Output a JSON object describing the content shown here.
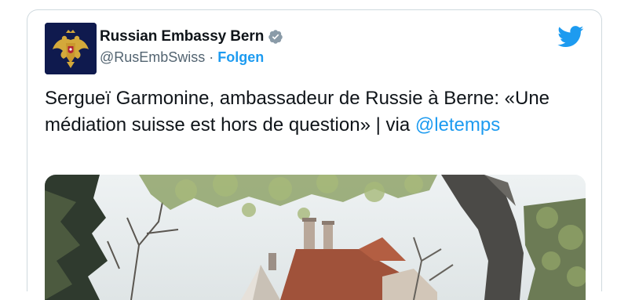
{
  "tweet": {
    "author_name": "Russian Embassy Bern",
    "handle": "@RusEmbSwiss",
    "separator": "·",
    "follow_label": "Folgen",
    "text_main": "Sergueï Garmonine, ambassadeur de Russie à Berne: «Une médiation suisse est hors de question» | via ",
    "mention": "@letemps"
  },
  "colors": {
    "accent": "#1d9bf0",
    "text": "#0f1419",
    "secondary": "#536471",
    "border": "#cfd9de",
    "avatar_bg": "#0f1a4e"
  },
  "icons": {
    "avatar": "coat-of-arms-icon",
    "verified": "verified-badge-icon",
    "brand": "twitter-bird-icon"
  }
}
